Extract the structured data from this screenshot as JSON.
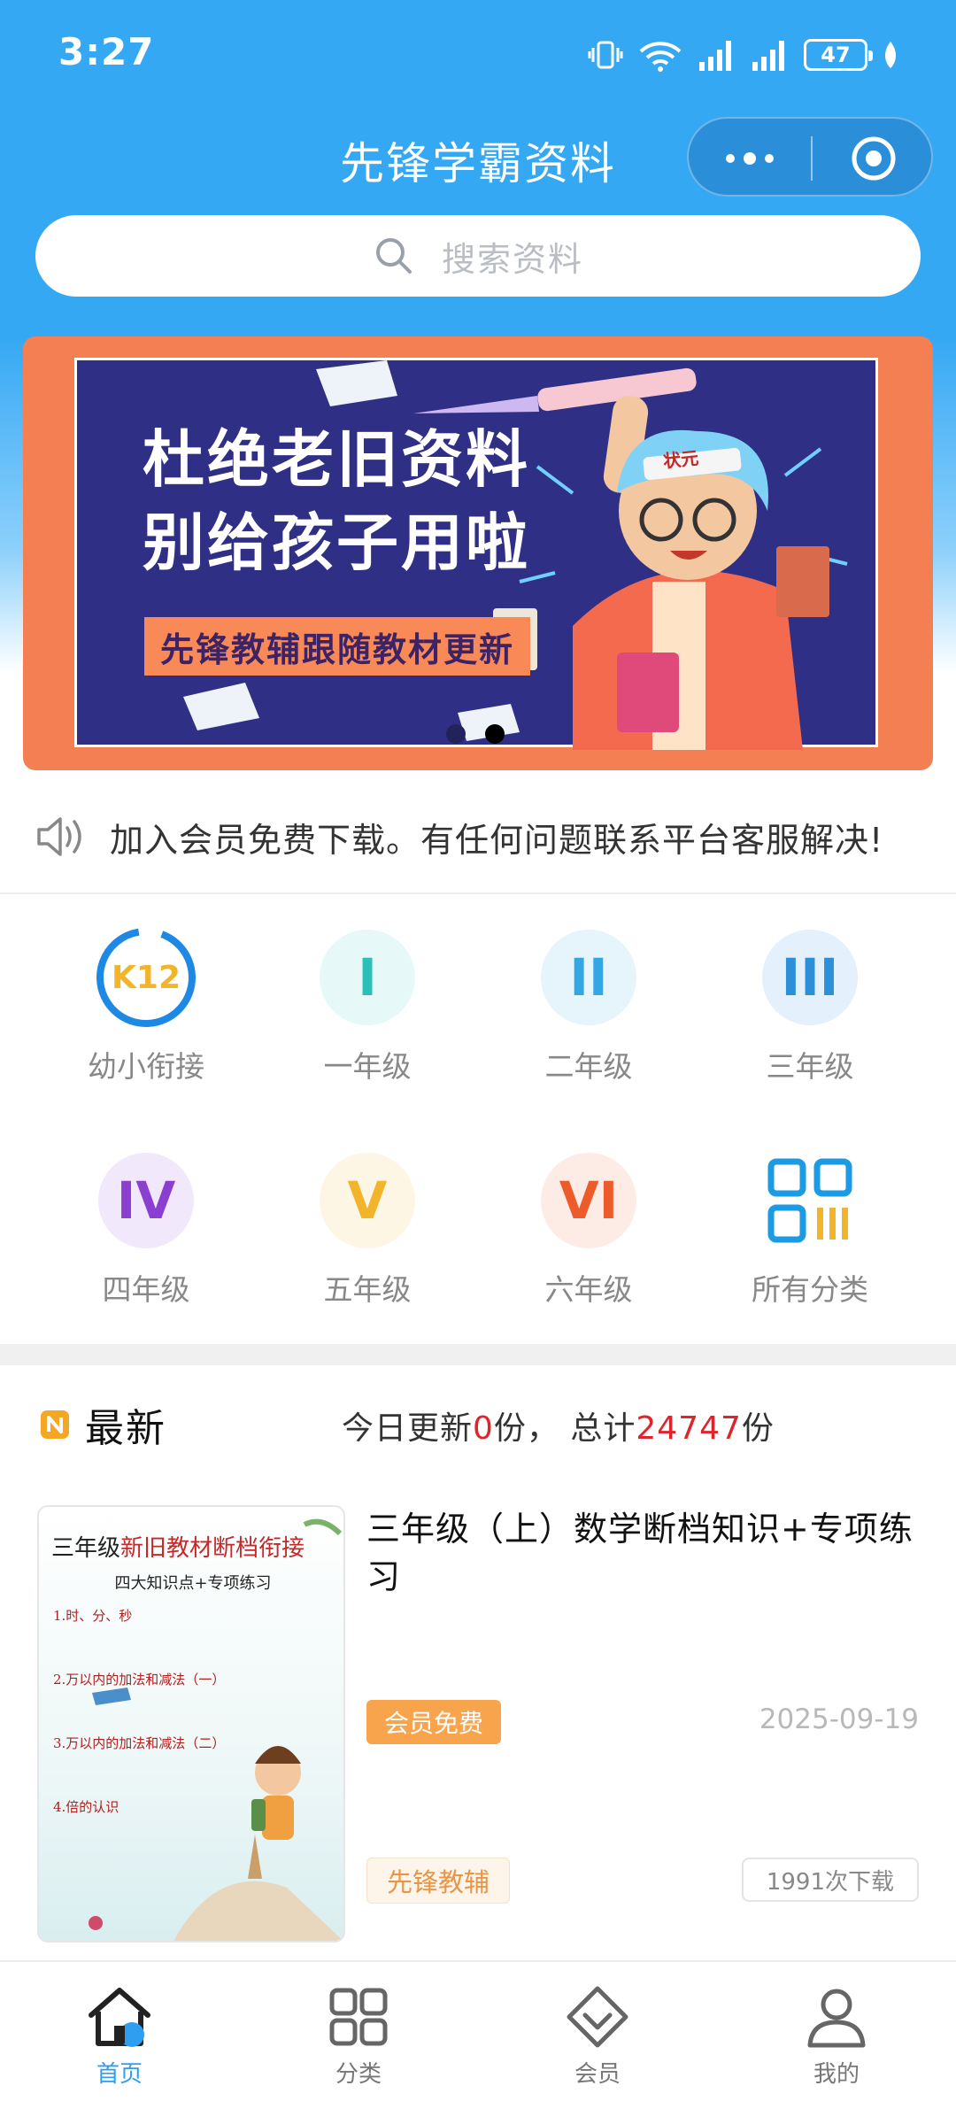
{
  "status_bar": {
    "time": "3:27",
    "battery": "47"
  },
  "header": {
    "title": "先锋学霸资料"
  },
  "search": {
    "placeholder": "搜索资料"
  },
  "banner": {
    "line1": "杜绝老旧资料",
    "line2": "别给孩子用啦",
    "subtitle": "先锋教辅跟随教材更新",
    "hat_text": "状元"
  },
  "notice": {
    "text": "加入会员免费下载。有任何问题联系平台客服解决!"
  },
  "grades": [
    {
      "icon_text": "K12",
      "label": "幼小衔接",
      "color": "#1e88e5"
    },
    {
      "icon_text": "I",
      "label": "一年级",
      "color": "#2bbfb8"
    },
    {
      "icon_text": "II",
      "label": "二年级",
      "color": "#33a7e6"
    },
    {
      "icon_text": "III",
      "label": "三年级",
      "color": "#2c8fd9"
    },
    {
      "icon_text": "IV",
      "label": "四年级",
      "color": "#8b3fd0"
    },
    {
      "icon_text": "V",
      "label": "五年级",
      "color": "#f2b42a"
    },
    {
      "icon_text": "VI",
      "label": "六年级",
      "color": "#ee5b2b"
    },
    {
      "icon_text": "",
      "label": "所有分类",
      "color": "#1b9be3"
    }
  ],
  "latest": {
    "title": "最新",
    "stats_prefix": "今日更新",
    "today_count": "0",
    "stats_mid": "份， 总计",
    "total_count": "24747",
    "stats_suffix": "份"
  },
  "card": {
    "thumb_title_1": "三年级",
    "thumb_title_2": "新旧教材断档衔接",
    "thumb_subtitle": "四大知识点+专项练习",
    "thumb_items": [
      "1.时、分、秒",
      "2.万以内的加法和减法（一）",
      "3.万以内的加法和减法（二）",
      "4.倍的认识"
    ],
    "title": "三年级（上）数学断档知识+专项练习",
    "vip_badge": "会员免费",
    "date": "2025-09-19",
    "brand": "先锋教辅",
    "downloads": "1991次下载"
  },
  "tabs": [
    {
      "label": "首页",
      "icon": "home-icon"
    },
    {
      "label": "分类",
      "icon": "category-icon"
    },
    {
      "label": "会员",
      "icon": "vip-icon"
    },
    {
      "label": "我的",
      "icon": "profile-icon"
    }
  ],
  "colors": {
    "primary": "#35a8f3",
    "accent_red": "#e0242b",
    "vip_orange": "#f7a44c"
  }
}
